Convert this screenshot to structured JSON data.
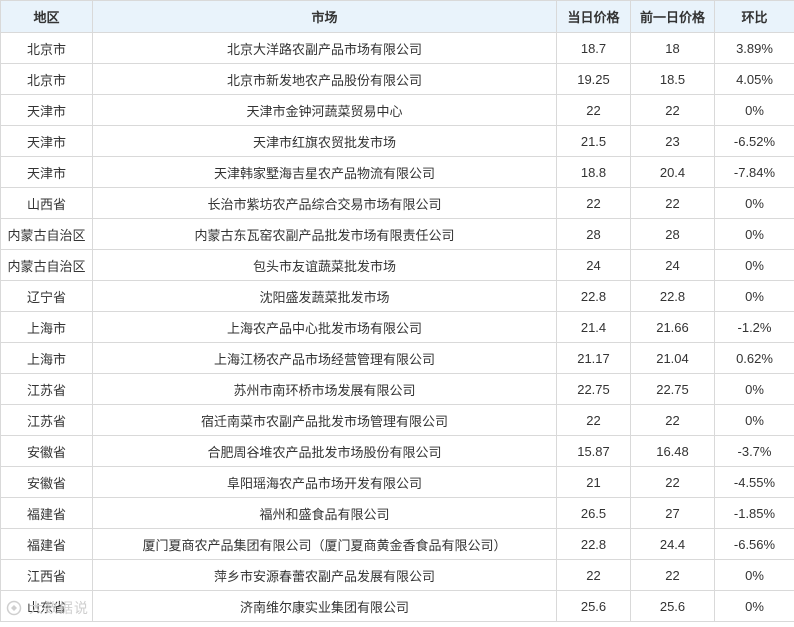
{
  "table": {
    "headers": [
      "地区",
      "市场",
      "当日价格",
      "前一日价格",
      "环比"
    ],
    "rows": [
      [
        "北京市",
        "北京大洋路农副产品市场有限公司",
        "18.7",
        "18",
        "3.89%"
      ],
      [
        "北京市",
        "北京市新发地农产品股份有限公司",
        "19.25",
        "18.5",
        "4.05%"
      ],
      [
        "天津市",
        "天津市金钟河蔬菜贸易中心",
        "22",
        "22",
        "0%"
      ],
      [
        "天津市",
        "天津市红旗农贸批发市场",
        "21.5",
        "23",
        "-6.52%"
      ],
      [
        "天津市",
        "天津韩家墅海吉星农产品物流有限公司",
        "18.8",
        "20.4",
        "-7.84%"
      ],
      [
        "山西省",
        "长治市紫坊农产品综合交易市场有限公司",
        "22",
        "22",
        "0%"
      ],
      [
        "内蒙古自治区",
        "内蒙古东瓦窑农副产品批发市场有限责任公司",
        "28",
        "28",
        "0%"
      ],
      [
        "内蒙古自治区",
        "包头市友谊蔬菜批发市场",
        "24",
        "24",
        "0%"
      ],
      [
        "辽宁省",
        "沈阳盛发蔬菜批发市场",
        "22.8",
        "22.8",
        "0%"
      ],
      [
        "上海市",
        "上海农产品中心批发市场有限公司",
        "21.4",
        "21.66",
        "-1.2%"
      ],
      [
        "上海市",
        "上海江杨农产品市场经营管理有限公司",
        "21.17",
        "21.04",
        "0.62%"
      ],
      [
        "江苏省",
        "苏州市南环桥市场发展有限公司",
        "22.75",
        "22.75",
        "0%"
      ],
      [
        "江苏省",
        "宿迁南菜市农副产品批发市场管理有限公司",
        "22",
        "22",
        "0%"
      ],
      [
        "安徽省",
        "合肥周谷堆农产品批发市场股份有限公司",
        "15.87",
        "16.48",
        "-3.7%"
      ],
      [
        "安徽省",
        "阜阳瑶海农产品市场开发有限公司",
        "21",
        "22",
        "-4.55%"
      ],
      [
        "福建省",
        "福州和盛食品有限公司",
        "26.5",
        "27",
        "-1.85%"
      ],
      [
        "福建省",
        "厦门夏商农产品集团有限公司（厦门夏商黄金香食品有限公司）",
        "22.8",
        "24.4",
        "-6.56%"
      ],
      [
        "江西省",
        "萍乡市安源春蕾农副产品发展有限公司",
        "22",
        "22",
        "0%"
      ],
      [
        "山东省",
        "济南维尔康实业集团有限公司",
        "25.6",
        "25.6",
        "0%"
      ]
    ]
  },
  "watermark": {
    "text": "大数据说",
    "icon": "logo-icon"
  },
  "colors": {
    "header_bg": "#e9f3fb",
    "border": "#d9d9d9",
    "text": "#333333"
  }
}
